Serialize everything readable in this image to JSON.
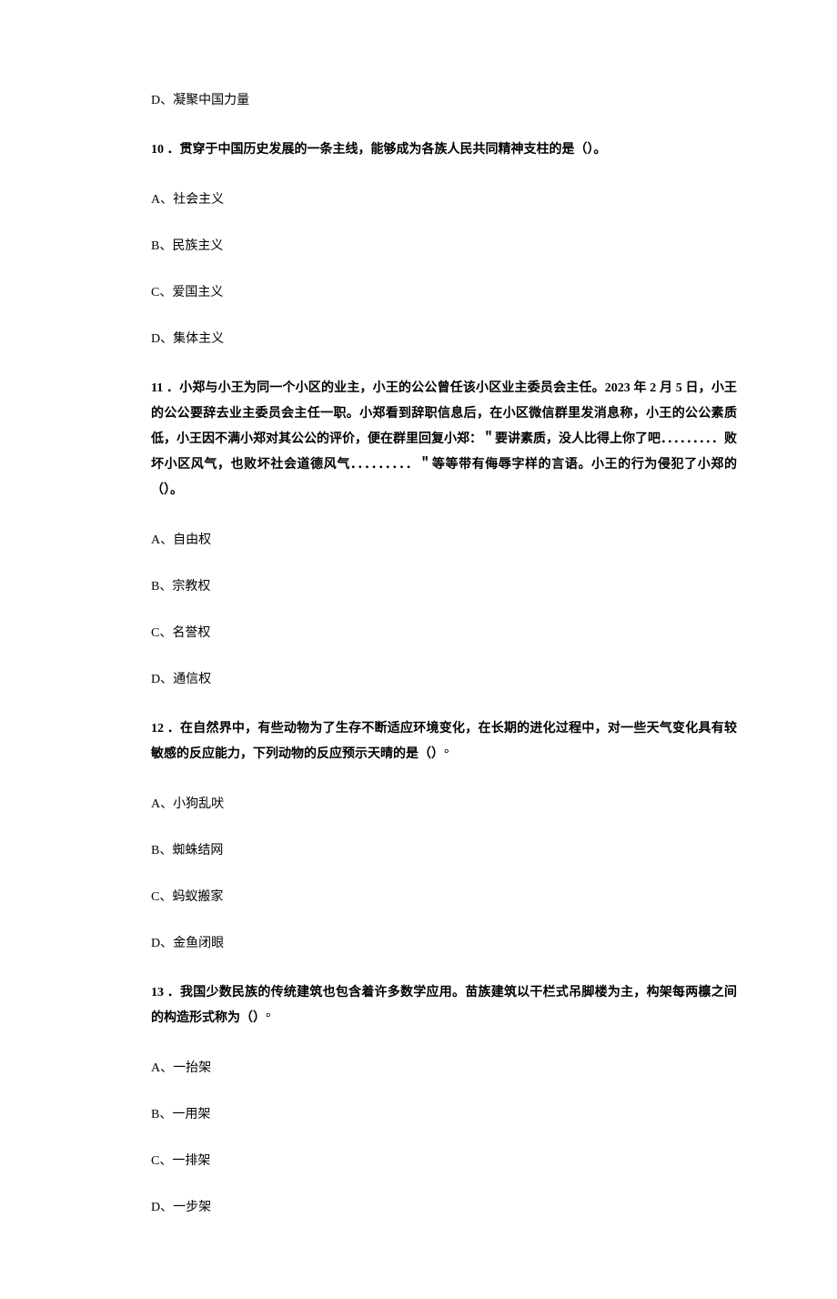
{
  "q9": {
    "optD": "D、凝聚中国力量"
  },
  "q10": {
    "stem": "10 ．贯穿于中国历史发展的一条主线，能够成为各族人民共同精神支柱的是（）。",
    "optA": "A、社会主义",
    "optB": "B、民族主义",
    "optC": "C、爱国主义",
    "optD": "D、集体主义"
  },
  "q11": {
    "stem": "11 ．小郑与小王为同一个小区的业主，小王的公公曾任该小区业主委员会主任。2023 年 2 月 5 日，小王的公公要辞去业主委员会主任一职。小郑看到辞职信息后，在小区微信群里发消息称，小王的公公素质低，小王因不满小郑对其公公的评价，便在群里回复小郑：＂要讲素质，没人比得上你了吧．．．．．．．．．败坏小区风气，也败坏社会道德风气．．．．．．．．．＂等等带有侮辱字样的言语。小王的行为侵犯了小郑的（）。",
    "optA": "A、自由权",
    "optB": "B、宗教权",
    "optC": "C、名誉权",
    "optD": "D、通信权"
  },
  "q12": {
    "stem": "12 ．在自然界中，有些动物为了生存不断适应环境变化，在长期的进化过程中，对一些天气变化具有较敏感的反应能力，下列动物的反应预示天晴的是（）°",
    "optA": "A、小狗乱吠",
    "optB": "B、蜘蛛结网",
    "optC": "C、蚂蚁搬家",
    "optD": "D、金鱼闭眼"
  },
  "q13": {
    "stem": "13 ．我国少数民族的传统建筑也包含着许多数学应用。苗族建筑以干栏式吊脚楼为主，构架每两檩之间的构造形式称为（）°",
    "optA": "A、一抬架",
    "optB": "B、一用架",
    "optC": "C、一排架",
    "optD": "D、一步架"
  }
}
